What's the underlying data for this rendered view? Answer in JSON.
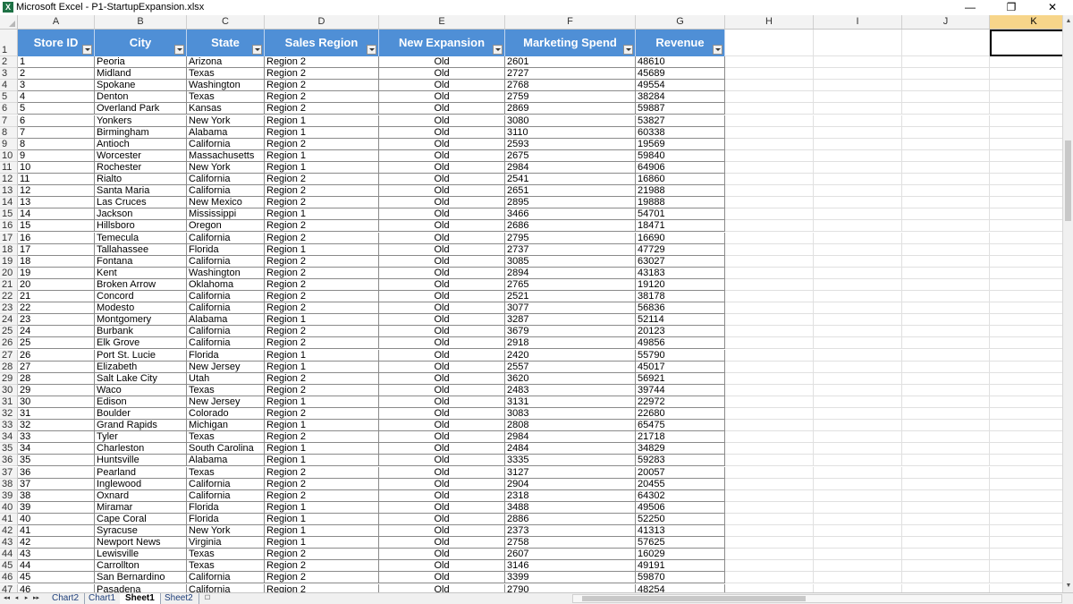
{
  "window": {
    "title": "Microsoft Excel - P1-StartupExpansion.xlsx",
    "icon": "excel-icon",
    "minimize_glyph": "—",
    "restore_glyph": "❐",
    "close_glyph": "✕"
  },
  "columns": [
    "A",
    "B",
    "C",
    "D",
    "E",
    "F",
    "G",
    "H",
    "I",
    "J",
    "K"
  ],
  "selected_column": "K",
  "header_row_number": "1",
  "headers": [
    "Store ID",
    "City",
    "State",
    "Sales Region",
    "New Expansion",
    "Marketing Spend",
    "Revenue"
  ],
  "rows": [
    [
      "2",
      "1",
      "Peoria",
      "Arizona",
      "Region 2",
      "Old",
      "2601",
      "48610"
    ],
    [
      "3",
      "2",
      "Midland",
      "Texas",
      "Region 2",
      "Old",
      "2727",
      "45689"
    ],
    [
      "4",
      "3",
      "Spokane",
      "Washington",
      "Region 2",
      "Old",
      "2768",
      "49554"
    ],
    [
      "5",
      "4",
      "Denton",
      "Texas",
      "Region 2",
      "Old",
      "2759",
      "38284"
    ],
    [
      "6",
      "5",
      "Overland Park",
      "Kansas",
      "Region 2",
      "Old",
      "2869",
      "59887"
    ],
    [
      "7",
      "6",
      "Yonkers",
      "New York",
      "Region 1",
      "Old",
      "3080",
      "53827"
    ],
    [
      "8",
      "7",
      "Birmingham",
      "Alabama",
      "Region 1",
      "Old",
      "3110",
      "60338"
    ],
    [
      "9",
      "8",
      "Antioch",
      "California",
      "Region 2",
      "Old",
      "2593",
      "19569"
    ],
    [
      "10",
      "9",
      "Worcester",
      "Massachusetts",
      "Region 1",
      "Old",
      "2675",
      "59840"
    ],
    [
      "11",
      "10",
      "Rochester",
      "New York",
      "Region 1",
      "Old",
      "2984",
      "64906"
    ],
    [
      "12",
      "11",
      "Rialto",
      "California",
      "Region 2",
      "Old",
      "2541",
      "16860"
    ],
    [
      "13",
      "12",
      "Santa Maria",
      "California",
      "Region 2",
      "Old",
      "2651",
      "21988"
    ],
    [
      "14",
      "13",
      "Las Cruces",
      "New Mexico",
      "Region 2",
      "Old",
      "2895",
      "19888"
    ],
    [
      "15",
      "14",
      "Jackson",
      "Mississippi",
      "Region 1",
      "Old",
      "3466",
      "54701"
    ],
    [
      "16",
      "15",
      "Hillsboro",
      "Oregon",
      "Region 2",
      "Old",
      "2686",
      "18471"
    ],
    [
      "17",
      "16",
      "Temecula",
      "California",
      "Region 2",
      "Old",
      "2795",
      "16690"
    ],
    [
      "18",
      "17",
      "Tallahassee",
      "Florida",
      "Region 1",
      "Old",
      "2737",
      "47729"
    ],
    [
      "19",
      "18",
      "Fontana",
      "California",
      "Region 2",
      "Old",
      "3085",
      "63027"
    ],
    [
      "20",
      "19",
      "Kent",
      "Washington",
      "Region 2",
      "Old",
      "2894",
      "43183"
    ],
    [
      "21",
      "20",
      "Broken Arrow",
      "Oklahoma",
      "Region 2",
      "Old",
      "2765",
      "19120"
    ],
    [
      "22",
      "21",
      "Concord",
      "California",
      "Region 2",
      "Old",
      "2521",
      "38178"
    ],
    [
      "23",
      "22",
      "Modesto",
      "California",
      "Region 2",
      "Old",
      "3077",
      "56836"
    ],
    [
      "24",
      "23",
      "Montgomery",
      "Alabama",
      "Region 1",
      "Old",
      "3287",
      "52114"
    ],
    [
      "25",
      "24",
      "Burbank",
      "California",
      "Region 2",
      "Old",
      "3679",
      "20123"
    ],
    [
      "26",
      "25",
      "Elk Grove",
      "California",
      "Region 2",
      "Old",
      "2918",
      "49856"
    ],
    [
      "27",
      "26",
      "Port St. Lucie",
      "Florida",
      "Region 1",
      "Old",
      "2420",
      "55790"
    ],
    [
      "28",
      "27",
      "Elizabeth",
      "New Jersey",
      "Region 1",
      "Old",
      "2557",
      "45017"
    ],
    [
      "29",
      "28",
      "Salt Lake City",
      "Utah",
      "Region 2",
      "Old",
      "3620",
      "56921"
    ],
    [
      "30",
      "29",
      "Waco",
      "Texas",
      "Region 2",
      "Old",
      "2483",
      "39744"
    ],
    [
      "31",
      "30",
      "Edison",
      "New Jersey",
      "Region 1",
      "Old",
      "3131",
      "22972"
    ],
    [
      "32",
      "31",
      "Boulder",
      "Colorado",
      "Region 2",
      "Old",
      "3083",
      "22680"
    ],
    [
      "33",
      "32",
      "Grand Rapids",
      "Michigan",
      "Region 1",
      "Old",
      "2808",
      "65475"
    ],
    [
      "34",
      "33",
      "Tyler",
      "Texas",
      "Region 2",
      "Old",
      "2984",
      "21718"
    ],
    [
      "35",
      "34",
      "Charleston",
      "South Carolina",
      "Region 1",
      "Old",
      "2484",
      "34829"
    ],
    [
      "36",
      "35",
      "Huntsville",
      "Alabama",
      "Region 1",
      "Old",
      "3335",
      "59283"
    ],
    [
      "37",
      "36",
      "Pearland",
      "Texas",
      "Region 2",
      "Old",
      "3127",
      "20057"
    ],
    [
      "38",
      "37",
      "Inglewood",
      "California",
      "Region 2",
      "Old",
      "2904",
      "20455"
    ],
    [
      "39",
      "38",
      "Oxnard",
      "California",
      "Region 2",
      "Old",
      "2318",
      "64302"
    ],
    [
      "40",
      "39",
      "Miramar",
      "Florida",
      "Region 1",
      "Old",
      "3488",
      "49506"
    ],
    [
      "41",
      "40",
      "Cape Coral",
      "Florida",
      "Region 1",
      "Old",
      "2886",
      "52250"
    ],
    [
      "42",
      "41",
      "Syracuse",
      "New York",
      "Region 1",
      "Old",
      "2373",
      "41313"
    ],
    [
      "43",
      "42",
      "Newport News",
      "Virginia",
      "Region 1",
      "Old",
      "2758",
      "57625"
    ],
    [
      "44",
      "43",
      "Lewisville",
      "Texas",
      "Region 2",
      "Old",
      "2607",
      "16029"
    ],
    [
      "45",
      "44",
      "Carrollton",
      "Texas",
      "Region 2",
      "Old",
      "3146",
      "49191"
    ],
    [
      "46",
      "45",
      "San Bernardino",
      "California",
      "Region 2",
      "Old",
      "3399",
      "59870"
    ],
    [
      "47",
      "46",
      "Pasadena",
      "California",
      "Region 2",
      "Old",
      "2790",
      "48254"
    ]
  ],
  "sheet_nav": [
    "◂◂",
    "◂",
    "▸",
    "▸▸"
  ],
  "sheet_tabs": [
    "Chart2",
    "Chart1",
    "Sheet1",
    "Sheet2"
  ],
  "active_tab": "Sheet1",
  "new_sheet_icon": "insert-worksheet-icon"
}
